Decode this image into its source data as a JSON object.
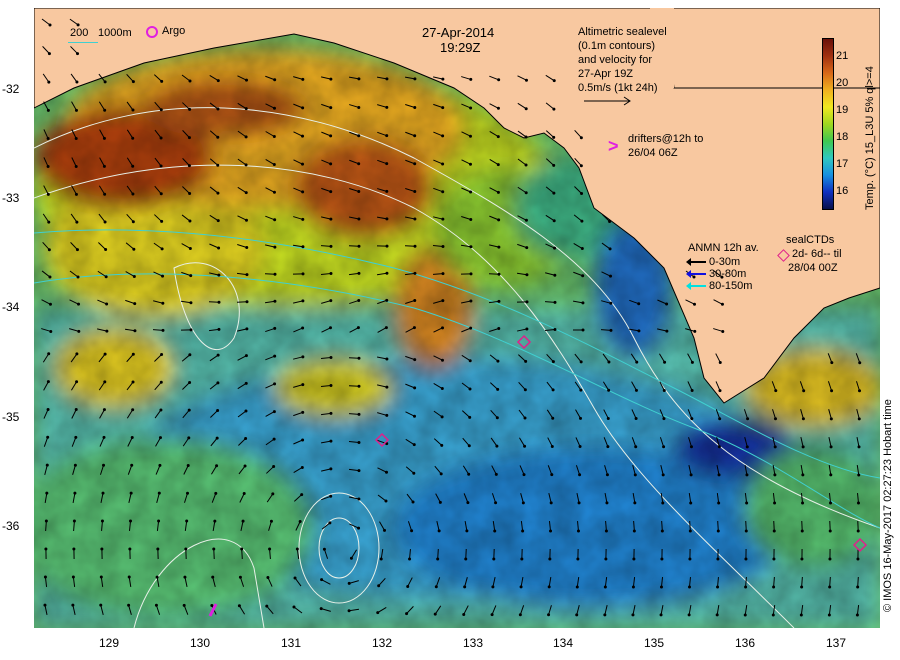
{
  "header": {
    "date": "27-Apr-2014",
    "time": "19:29Z"
  },
  "depth_legend": {
    "label_200": "200",
    "label_1000": "1000m",
    "argo_label": "Argo"
  },
  "altimetry_note": {
    "line1": "Altimetric sealevel",
    "line2": "(0.1m contours)",
    "line3": "and velocity for",
    "line4": "27-Apr 19Z",
    "line5": "0.5m/s (1kt 24h)"
  },
  "drifters": {
    "line1": "drifters@12h to",
    "line2": "26/04 06Z",
    "marker_color": "#e020e0"
  },
  "anmn": {
    "title": "ANMN 12h av.",
    "rows": [
      {
        "label": "0-30m",
        "color": "#000000"
      },
      {
        "label": "30-80m",
        "color": "#1010e0"
      },
      {
        "label": "80-150m",
        "color": "#00e0e0"
      }
    ]
  },
  "seal_ctds": {
    "title": "sealCTDs",
    "line1": "2d- 6d-- til",
    "line2": "28/04 00Z",
    "marker_color": "#e0208a"
  },
  "colorbar": {
    "label": "Temp. (°C) 15_L3U 5% ql>=4",
    "ticks": [
      "21",
      "20",
      "19",
      "18",
      "17",
      "16"
    ],
    "vmin": 15.5,
    "vmax": 21.5,
    "colors": [
      "#08104a",
      "#1030c0",
      "#1890e0",
      "#30c8c0",
      "#40c850",
      "#a0d820",
      "#f0e820",
      "#f0b020",
      "#d86818",
      "#a03010",
      "#6a1008"
    ]
  },
  "axes": {
    "y_ticks": [
      "-32",
      "-33",
      "-34",
      "-35",
      "-36"
    ],
    "x_ticks": [
      "129",
      "130",
      "131",
      "132",
      "133",
      "134",
      "135",
      "136",
      "137"
    ],
    "lon_range": [
      128.2,
      137.5
    ],
    "lat_range": [
      -36.95,
      -31.25
    ]
  },
  "credit": "© IMOS 16-May-2017 02:27:23 Hobart time",
  "colors": {
    "land": "#f8c8a0",
    "contour": "#e8f0e8",
    "isobath": "#40d0d0"
  }
}
